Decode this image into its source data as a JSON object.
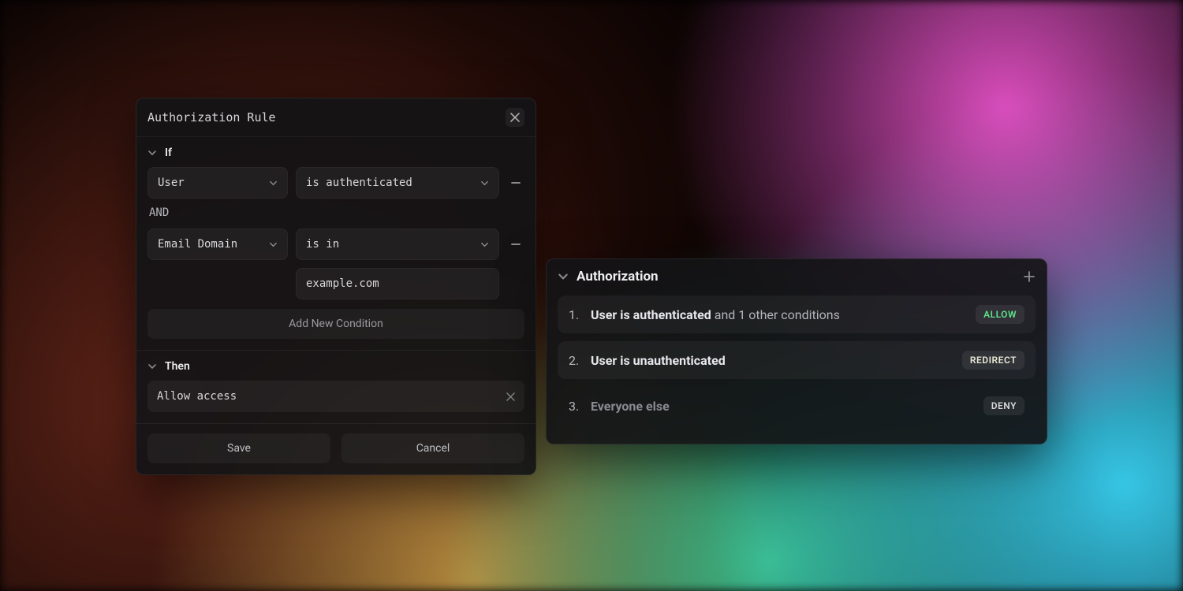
{
  "ruleEditor": {
    "title": "Authorization Rule",
    "if": {
      "label": "If",
      "conditions": [
        {
          "subject": "User",
          "operator": "is authenticated"
        },
        {
          "subject": "Email Domain",
          "operator": "is in",
          "value": "example.com"
        }
      ],
      "joiner": "AND",
      "addButton": "Add New Condition"
    },
    "then": {
      "label": "Then",
      "action": "Allow access"
    },
    "buttons": {
      "save": "Save",
      "cancel": "Cancel"
    }
  },
  "ruleList": {
    "title": "Authorization",
    "items": [
      {
        "num": "1.",
        "primary": "User is authenticated",
        "tail": " and 1 other conditions",
        "badge": "ALLOW",
        "badgeType": "allow",
        "filled": true
      },
      {
        "num": "2.",
        "primary": "User is unauthenticated",
        "tail": "",
        "badge": "REDIRECT",
        "badgeType": "redirect",
        "filled": true
      },
      {
        "num": "3.",
        "primary": "Everyone else",
        "tail": "",
        "badge": "DENY",
        "badgeType": "deny",
        "filled": false,
        "dim": true
      }
    ]
  }
}
